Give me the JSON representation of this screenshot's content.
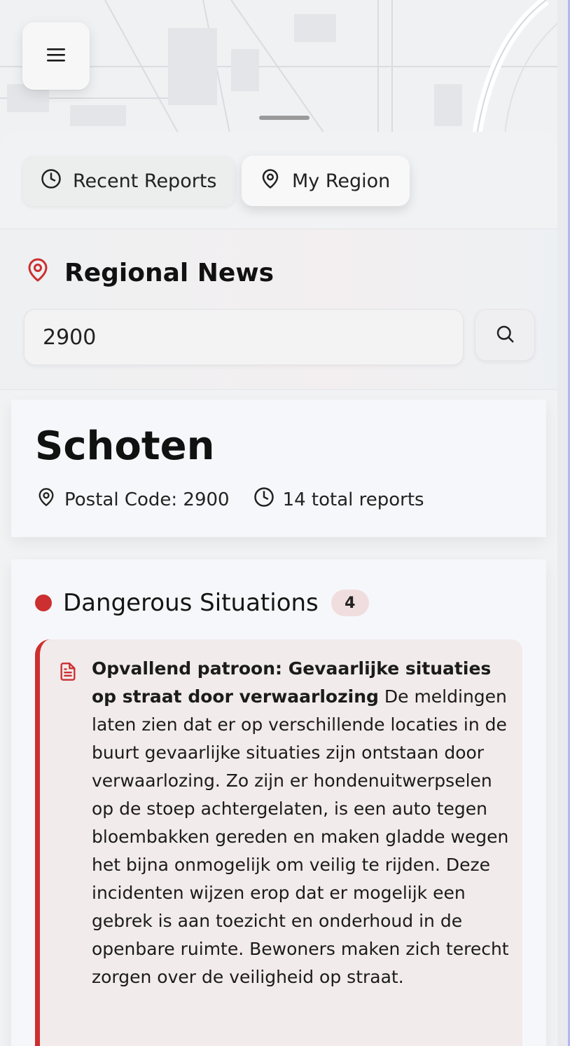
{
  "menu": {
    "icon": "hamburger-menu-icon"
  },
  "tabs": [
    {
      "label": "Recent Reports",
      "icon": "clock-icon"
    },
    {
      "label": "My Region",
      "icon": "map-pin-icon"
    }
  ],
  "regional": {
    "title": "Regional News",
    "icon": "map-pin-icon",
    "search_value": "2900",
    "search_button_icon": "search-icon"
  },
  "location": {
    "name": "Schoten",
    "postal_code_label": "Postal Code: 2900",
    "total_reports_label": "14 total reports"
  },
  "category": {
    "title": "Dangerous Situations",
    "count": "4",
    "color": "#cc2f2f",
    "report": {
      "icon": "document-icon",
      "headline": "Opvallend patroon: Gevaarlijke situaties op straat door verwaarlozing",
      "body": "De meldingen laten zien dat er op verschillende locaties in de buurt gevaarlijke situaties zijn ontstaan door verwaarlozing. Zo zijn er hondenuitwerpselen op de stoep achtergelaten, is een auto tegen bloembakken gereden en maken gladde wegen het bijna onmogelijk om veilig te rijden. Deze incidenten wijzen erop dat er mogelijk een gebrek is aan toezicht en onderhoud in de openbare ruimte. Bewoners maken zich terecht zorgen over de veiligheid op straat."
    }
  }
}
